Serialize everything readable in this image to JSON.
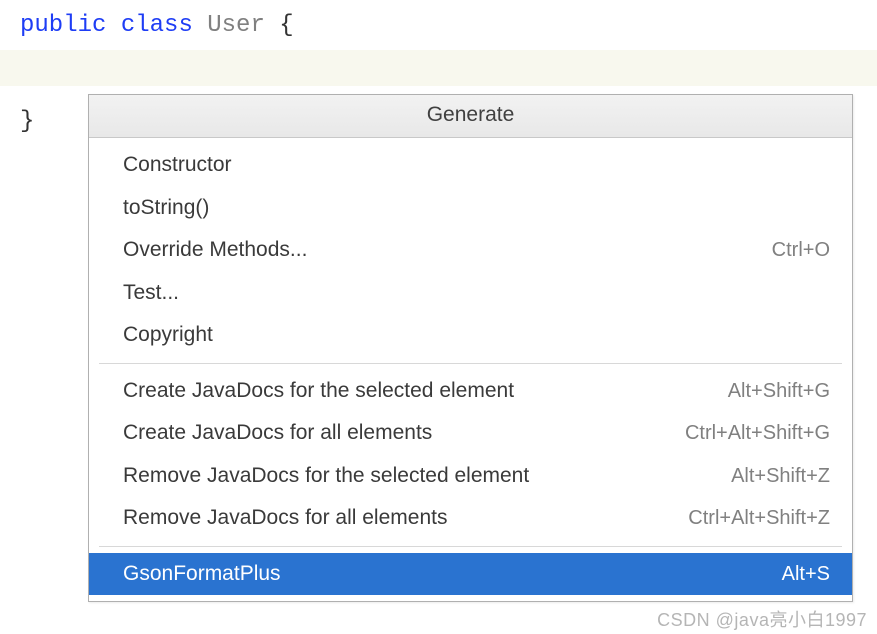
{
  "code": {
    "kw_public": "public",
    "kw_class": "class",
    "classname": "User",
    "open_brace": "{",
    "close_brace": "}"
  },
  "popup": {
    "title": "Generate",
    "groups": [
      {
        "items": [
          {
            "label": "Constructor",
            "shortcut": "",
            "selected": false
          },
          {
            "label": "toString()",
            "shortcut": "",
            "selected": false
          },
          {
            "label": "Override Methods...",
            "shortcut": "Ctrl+O",
            "selected": false
          },
          {
            "label": "Test...",
            "shortcut": "",
            "selected": false
          },
          {
            "label": "Copyright",
            "shortcut": "",
            "selected": false
          }
        ]
      },
      {
        "items": [
          {
            "label": "Create JavaDocs for the selected element",
            "shortcut": "Alt+Shift+G",
            "selected": false
          },
          {
            "label": "Create JavaDocs for all elements",
            "shortcut": "Ctrl+Alt+Shift+G",
            "selected": false
          },
          {
            "label": "Remove JavaDocs for the selected element",
            "shortcut": "Alt+Shift+Z",
            "selected": false
          },
          {
            "label": "Remove JavaDocs for all elements",
            "shortcut": "Ctrl+Alt+Shift+Z",
            "selected": false
          }
        ]
      },
      {
        "items": [
          {
            "label": "GsonFormatPlus",
            "shortcut": "Alt+S",
            "selected": true
          }
        ]
      }
    ]
  },
  "watermark": "CSDN @java亮小白1997"
}
